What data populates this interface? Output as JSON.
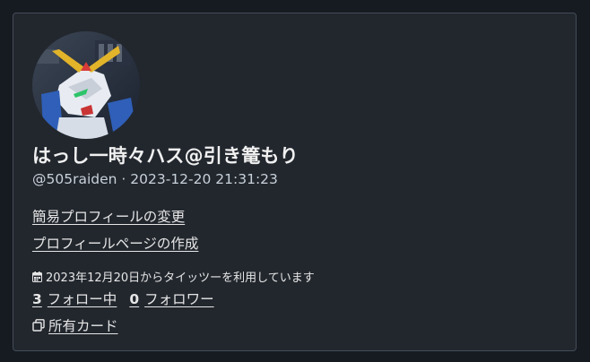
{
  "profile": {
    "display_name": "はっし一時々ハス@引き篭もり",
    "handle": "@505raiden",
    "separator": "·",
    "timestamp": "2023-12-20 21:31:23",
    "avatar_icon": "gundam-avatar-image"
  },
  "links": {
    "edit_profile": "簡易プロフィールの変更",
    "create_profile_page": "プロフィールページの作成"
  },
  "since": {
    "icon": "calendar-icon",
    "text": "2023年12月20日からタイッツーを利用しています"
  },
  "follow": {
    "following_count": "3",
    "following_label": "フォロー中",
    "followers_count": "0",
    "followers_label": "フォロワー"
  },
  "cards": {
    "icon": "copy-icon",
    "label": "所有カード"
  },
  "colors": {
    "page_bg": "#161b22",
    "card_bg": "#22272e",
    "card_border": "#444c56",
    "text": "#e6e6e6"
  }
}
